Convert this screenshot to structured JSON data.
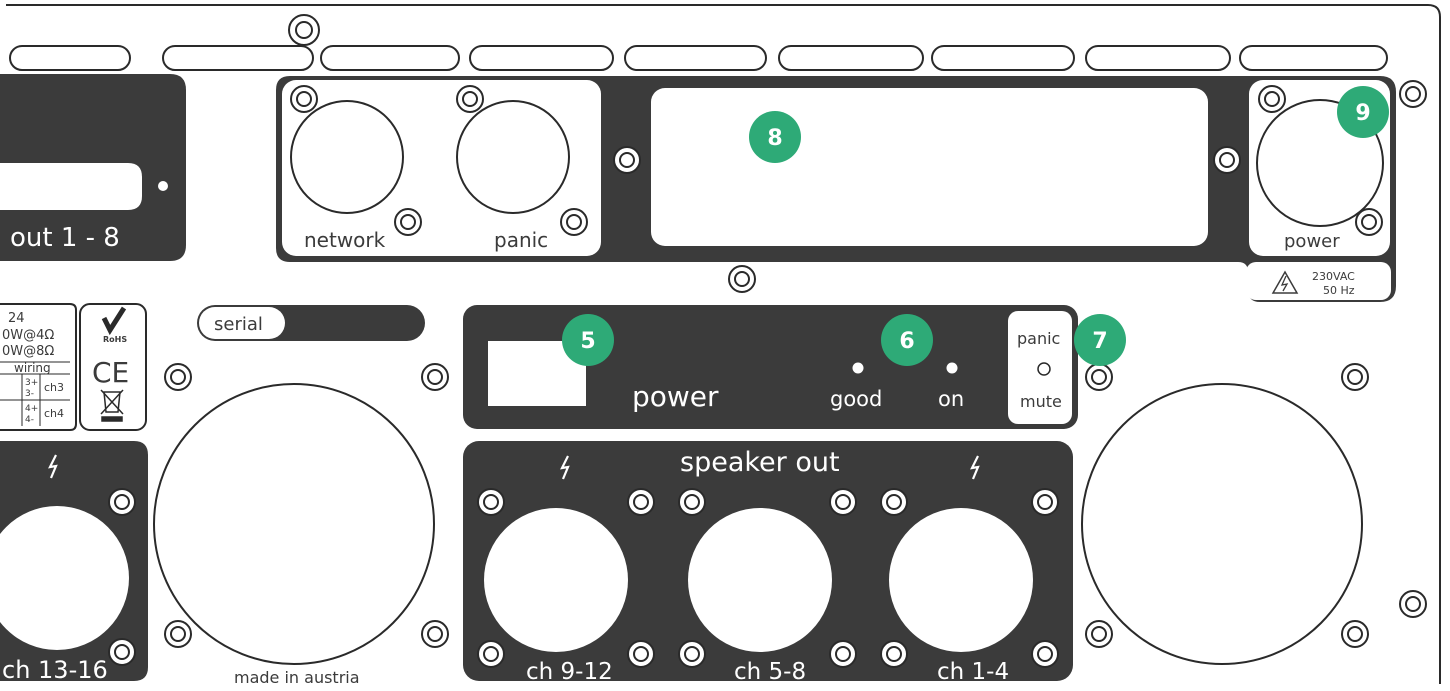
{
  "labels": {
    "d_sub_output": "out 1 - 8",
    "network": "network",
    "panic_input": "panic",
    "power_inlet": "power",
    "mains_voltage": "230VAC",
    "mains_frequency": "50 Hz",
    "serial": "serial",
    "power_switch": "power",
    "good": "good",
    "on": "on",
    "panic_mute_top": "panic",
    "panic_mute_bottom": "mute",
    "speaker_out": "speaker out",
    "ch_13_16": "ch 13-16",
    "ch_9_12": "ch 9-12",
    "ch_5_8": "ch 5-8",
    "ch_1_4": "ch 1-4",
    "made_in": "made in austria",
    "spec_line_1": "24",
    "spec_line_2": "0W@4Ω",
    "spec_line_3": "0W@8Ω",
    "wiring": "wiring",
    "wiring_ch3": "ch3",
    "wiring_ch4": "ch4",
    "wiring_3p": "3+",
    "wiring_3m": "3-",
    "wiring_4p": "4+",
    "wiring_4m": "4-",
    "rohs": "RoHS",
    "ce": "CE"
  },
  "callouts": [
    {
      "number": "8",
      "target": "display-window"
    },
    {
      "number": "9",
      "target": "power-inlet"
    },
    {
      "number": "5",
      "target": "power-switch"
    },
    {
      "number": "6",
      "target": "status-leds"
    },
    {
      "number": "7",
      "target": "panic-mute-led"
    }
  ],
  "colors": {
    "panel": "#3b3b3b",
    "outline": "#2a2a2a",
    "callout": "#2eaa77",
    "background": "#ffffff"
  },
  "icons": [
    "mounting-screw-icon",
    "lightning-bolt-icon",
    "high-voltage-warning-icon",
    "rohs-checkmark-icon",
    "weee-bin-icon"
  ]
}
